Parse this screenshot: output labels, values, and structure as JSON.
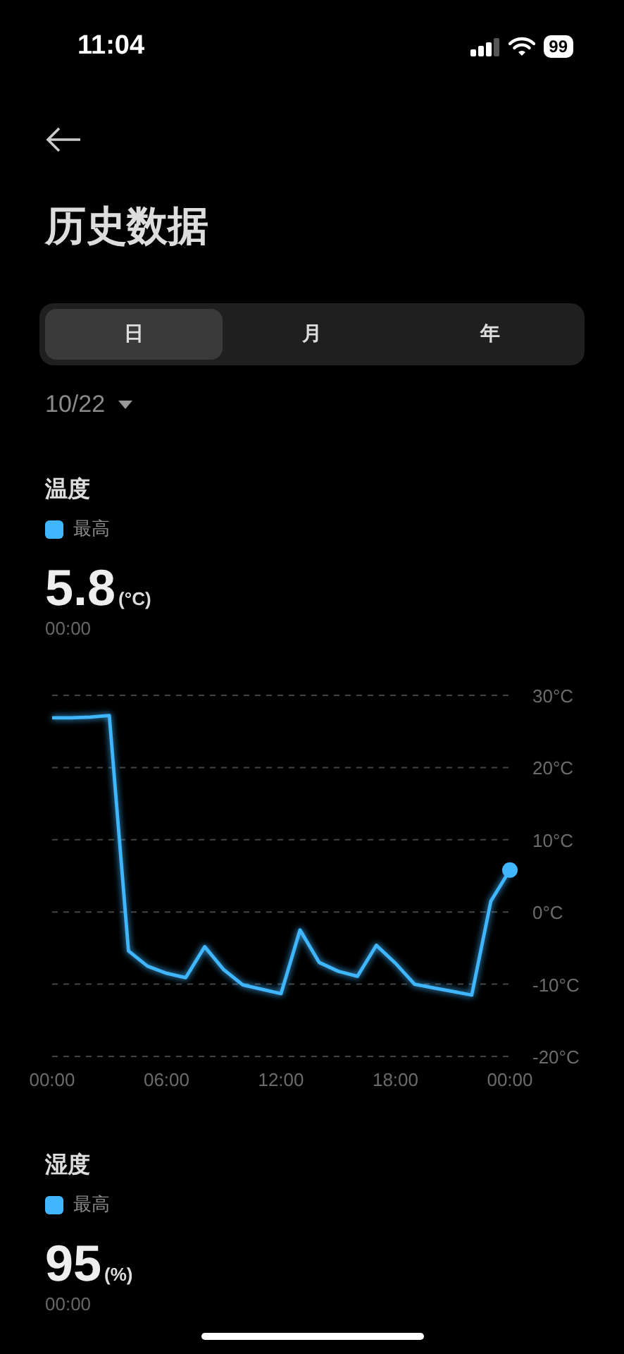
{
  "status_bar": {
    "time": "11:04",
    "battery": "99"
  },
  "title": "历史数据",
  "tabs": [
    {
      "label": "日",
      "selected": true
    },
    {
      "label": "月",
      "selected": false
    },
    {
      "label": "年",
      "selected": false
    }
  ],
  "date": "10/22",
  "sections": [
    {
      "title": "温度",
      "value": "5.8",
      "unit": "(°C)",
      "time": "00:00",
      "chart_data": {
        "type": "line",
        "grid": true,
        "x": [
          0,
          1,
          2,
          3,
          4,
          5,
          6,
          7,
          8,
          9,
          10,
          11,
          12,
          13,
          14,
          15,
          16,
          17,
          18,
          19,
          20,
          21,
          22,
          23,
          24
        ],
        "series": [
          {
            "name": "最高",
            "color": "#3fb6ff",
            "values": [
              26.9,
              26.9,
              27.0,
              27.2,
              -5.4,
              -7.5,
              -8.5,
              -9.1,
              -4.8,
              -8.0,
              -10.1,
              -10.7,
              -11.3,
              -2.5,
              -7.0,
              -8.2,
              -8.9,
              -4.6,
              -7.1,
              -10.0,
              -10.5,
              -11.0,
              -11.5,
              1.5,
              5.8
            ]
          }
        ],
        "xlim": [
          0,
          24
        ],
        "ylim": [
          -20,
          30
        ],
        "xticks": [
          {
            "value": 0,
            "label": "00:00"
          },
          {
            "value": 6,
            "label": "06:00"
          },
          {
            "value": 12,
            "label": "12:00"
          },
          {
            "value": 18,
            "label": "18:00"
          },
          {
            "value": 24,
            "label": "00:00"
          }
        ],
        "yticks": [
          {
            "value": 30,
            "label": "30°C"
          },
          {
            "value": 20,
            "label": "20°C"
          },
          {
            "value": 10,
            "label": "10°C"
          },
          {
            "value": 0,
            "label": "0°C"
          },
          {
            "value": -10,
            "label": "-10°C"
          },
          {
            "value": -20,
            "label": "-20°C"
          }
        ]
      }
    },
    {
      "title": "湿度",
      "legend": {
        "label": "最高",
        "color": "#3fb6ff"
      },
      "value": "95",
      "unit": "(%)",
      "time": "00:00"
    }
  ]
}
